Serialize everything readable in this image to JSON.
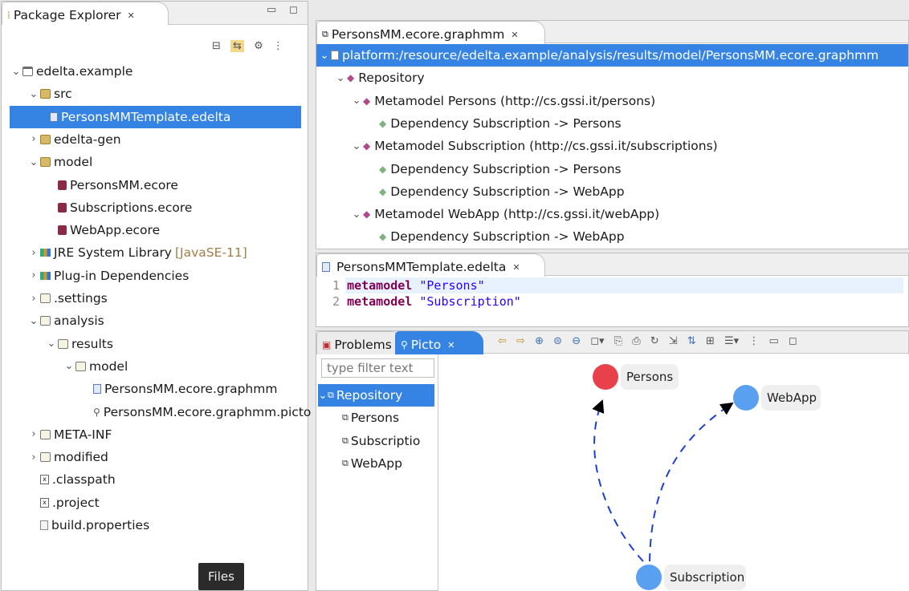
{
  "package_explorer": {
    "tab_title": "Package Explorer",
    "tree": [
      {
        "label": "edelta.example",
        "indent": 0,
        "chev": "v",
        "icon": "project-icon"
      },
      {
        "label": "src",
        "indent": 1,
        "chev": "v",
        "icon": "source-folder-icon"
      },
      {
        "label": "PersonsMMTemplate.edelta",
        "indent": 2,
        "chev": "",
        "icon": "file-icon",
        "selected": true
      },
      {
        "label": "edelta-gen",
        "indent": 1,
        "chev": ">",
        "icon": "source-folder-icon"
      },
      {
        "label": "model",
        "indent": 1,
        "chev": "v",
        "icon": "source-folder-icon"
      },
      {
        "label": "PersonsMM.ecore",
        "indent": 2,
        "chev": "",
        "icon": "ecore-icon"
      },
      {
        "label": "Subscriptions.ecore",
        "indent": 2,
        "chev": "",
        "icon": "ecore-icon"
      },
      {
        "label": "WebApp.ecore",
        "indent": 2,
        "chev": "",
        "icon": "ecore-icon"
      },
      {
        "label": "JRE System Library",
        "suffix": "[JavaSE-11]",
        "indent": 1,
        "chev": ">",
        "icon": "library-icon"
      },
      {
        "label": "Plug-in Dependencies",
        "indent": 1,
        "chev": ">",
        "icon": "library-icon"
      },
      {
        "label": ".settings",
        "indent": 1,
        "chev": ">",
        "icon": "folder-icon"
      },
      {
        "label": "analysis",
        "indent": 1,
        "chev": "v",
        "icon": "folder-icon"
      },
      {
        "label": "results",
        "indent": 2,
        "chev": "v",
        "icon": "folder-icon"
      },
      {
        "label": "model",
        "indent": 3,
        "chev": "v",
        "icon": "folder-icon"
      },
      {
        "label": "PersonsMM.ecore.graphmm",
        "indent": 4,
        "chev": "",
        "icon": "file-icon"
      },
      {
        "label": "PersonsMM.ecore.graphmm.picto",
        "indent": 4,
        "chev": "",
        "icon": "picto-icon"
      },
      {
        "label": "META-INF",
        "indent": 1,
        "chev": ">",
        "icon": "folder-icon"
      },
      {
        "label": "modified",
        "indent": 1,
        "chev": ">",
        "icon": "folder-icon"
      },
      {
        "label": ".classpath",
        "indent": 1,
        "chev": "",
        "icon": "xml-file-icon"
      },
      {
        "label": ".project",
        "indent": 1,
        "chev": "",
        "icon": "xml-file-icon"
      },
      {
        "label": "build.properties",
        "indent": 1,
        "chev": "",
        "icon": "properties-file-icon"
      }
    ],
    "tooltip": "Files"
  },
  "graphmm_editor": {
    "tab_title": "PersonsMM.ecore.graphmm",
    "tree": [
      {
        "label": "platform:/resource/edelta.example/analysis/results/model/PersonsMM.ecore.graphmm",
        "indent": 0,
        "chev": "v",
        "kind": "resource",
        "selected": true
      },
      {
        "label": "Repository",
        "indent": 1,
        "chev": "v",
        "kind": "node"
      },
      {
        "label": "Metamodel Persons (http://cs.gssi.it/persons)",
        "indent": 2,
        "chev": "v",
        "kind": "node"
      },
      {
        "label": "Dependency Subscription -> Persons",
        "indent": 3,
        "chev": "",
        "kind": "dep"
      },
      {
        "label": "Metamodel Subscription (http://cs.gssi.it/subscriptions)",
        "indent": 2,
        "chev": "v",
        "kind": "node"
      },
      {
        "label": "Dependency Subscription -> Persons",
        "indent": 3,
        "chev": "",
        "kind": "dep"
      },
      {
        "label": "Dependency Subscription -> WebApp",
        "indent": 3,
        "chev": "",
        "kind": "dep"
      },
      {
        "label": "Metamodel WebApp (http://cs.gssi.it/webApp)",
        "indent": 2,
        "chev": "v",
        "kind": "node"
      },
      {
        "label": "Dependency Subscription -> WebApp",
        "indent": 3,
        "chev": "",
        "kind": "dep"
      }
    ]
  },
  "edelta_editor": {
    "tab_title": "PersonsMMTemplate.edelta",
    "lines": [
      {
        "num": "1",
        "keyword": "metamodel",
        "string": "\"Persons\""
      },
      {
        "num": "2",
        "keyword": "metamodel",
        "string": "\"Subscription\""
      }
    ]
  },
  "bottom_view": {
    "tabs": [
      "Problems",
      "Picto"
    ],
    "filter_placeholder": "type filter text",
    "tree": [
      {
        "label": "Repository",
        "indent": 0,
        "chev": "v",
        "selected": true
      },
      {
        "label": "Persons",
        "indent": 1,
        "chev": ""
      },
      {
        "label": "Subscriptio",
        "indent": 1,
        "chev": ""
      },
      {
        "label": "WebApp",
        "indent": 1,
        "chev": ""
      }
    ],
    "graph": {
      "nodes": [
        {
          "label": "Persons",
          "color": "#e8414b"
        },
        {
          "label": "WebApp",
          "color": "#5aa0f0"
        },
        {
          "label": "Subscription",
          "color": "#5aa0f0"
        }
      ],
      "edge_color": "#1a3fd6"
    }
  }
}
